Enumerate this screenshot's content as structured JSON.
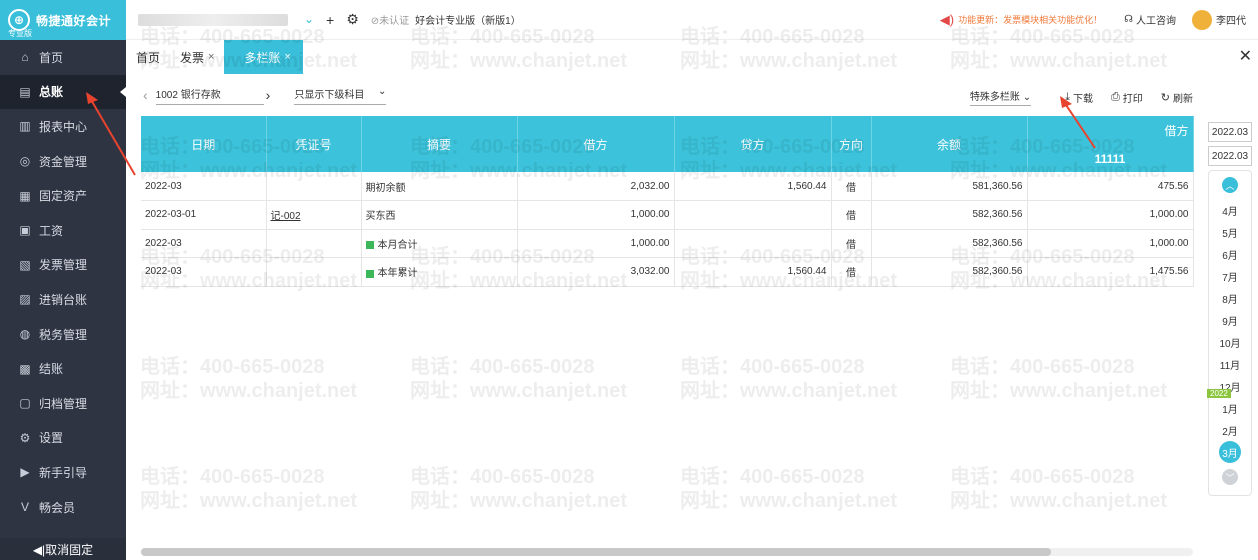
{
  "brand": {
    "name": "畅捷通好会计",
    "sub": "专业版",
    "logo_glyph": "⊕"
  },
  "sidebar": {
    "items": [
      {
        "label": "首页",
        "icon": "home-icon",
        "glyph": "⌂"
      },
      {
        "label": "总账",
        "icon": "ledger-icon",
        "glyph": "▤",
        "active": true
      },
      {
        "label": "报表中心",
        "icon": "chart-icon",
        "glyph": "▥"
      },
      {
        "label": "资金管理",
        "icon": "money-icon",
        "glyph": "◎"
      },
      {
        "label": "固定资产",
        "icon": "asset-icon",
        "glyph": "▦"
      },
      {
        "label": "工资",
        "icon": "salary-icon",
        "glyph": "▣"
      },
      {
        "label": "发票管理",
        "icon": "invoice-icon",
        "glyph": "▧"
      },
      {
        "label": "进销台账",
        "icon": "inventory-icon",
        "glyph": "▨"
      },
      {
        "label": "税务管理",
        "icon": "tax-icon",
        "glyph": "◍"
      },
      {
        "label": "结账",
        "icon": "checkout-icon",
        "glyph": "▩"
      },
      {
        "label": "归档管理",
        "icon": "archive-icon",
        "glyph": "▢"
      },
      {
        "label": "设置",
        "icon": "settings-icon",
        "glyph": "⚙"
      },
      {
        "label": "新手引导",
        "icon": "guide-icon",
        "glyph": "▶"
      },
      {
        "label": "畅会员",
        "icon": "vip-icon",
        "glyph": "V"
      }
    ],
    "unpin": "◀|取消固定"
  },
  "topbar": {
    "cert": "⊘未认证",
    "edition": "好会计专业版（新版1）",
    "notice": "功能更新：发票模块相关功能优化！",
    "support": "人工咨询",
    "user": "李四代"
  },
  "tabs": [
    {
      "label": "首页",
      "closable": false
    },
    {
      "label": "发票",
      "closable": true
    },
    {
      "label": "多栏账",
      "closable": true,
      "active": true
    }
  ],
  "toolbar": {
    "subject": "1002  银行存款",
    "filter": "只显示下级科目",
    "special": "特殊多栏账",
    "download": "下载",
    "print": "打印",
    "refresh": "刷新"
  },
  "table": {
    "headers": [
      "日期",
      "凭证号",
      "摘要",
      "借方",
      "贷方",
      "方向",
      "余额",
      "借方"
    ],
    "sub_header": "11111",
    "rows": [
      {
        "date": "2022-03",
        "voucher": "",
        "summary": "期初余额",
        "tag": false,
        "debit": "2,032.00",
        "credit": "1,560.44",
        "dir": "借",
        "balance": "581,360.56",
        "col8": "475.56"
      },
      {
        "date": "2022-03-01",
        "voucher": "记-002",
        "summary": "买东西",
        "tag": false,
        "debit": "1,000.00",
        "credit": "",
        "dir": "借",
        "balance": "582,360.56",
        "col8": "1,000.00"
      },
      {
        "date": "2022-03",
        "voucher": "",
        "summary": "本月合计",
        "tag": true,
        "debit": "1,000.00",
        "credit": "",
        "dir": "借",
        "balance": "582,360.56",
        "col8": "1,000.00"
      },
      {
        "date": "2022-03",
        "voucher": "",
        "summary": "本年累计",
        "tag": true,
        "debit": "3,032.00",
        "credit": "1,560.44",
        "dir": "借",
        "balance": "582,360.56",
        "col8": "1,475.56"
      }
    ]
  },
  "datepanel": {
    "from": "2022.03",
    "to": "2022.03",
    "year_tag": "2022",
    "months": [
      "4月",
      "5月",
      "6月",
      "7月",
      "8月",
      "9月",
      "10月",
      "11月",
      "12月",
      "1月",
      "2月",
      "3月"
    ],
    "current": "3月"
  },
  "watermark": {
    "phone": "电话：400-665-0028",
    "site": "网址：www.chanjet.net"
  },
  "colors": {
    "accent": "#39bfd9",
    "sidebar": "#2f3443",
    "arrow": "#e8432e"
  }
}
